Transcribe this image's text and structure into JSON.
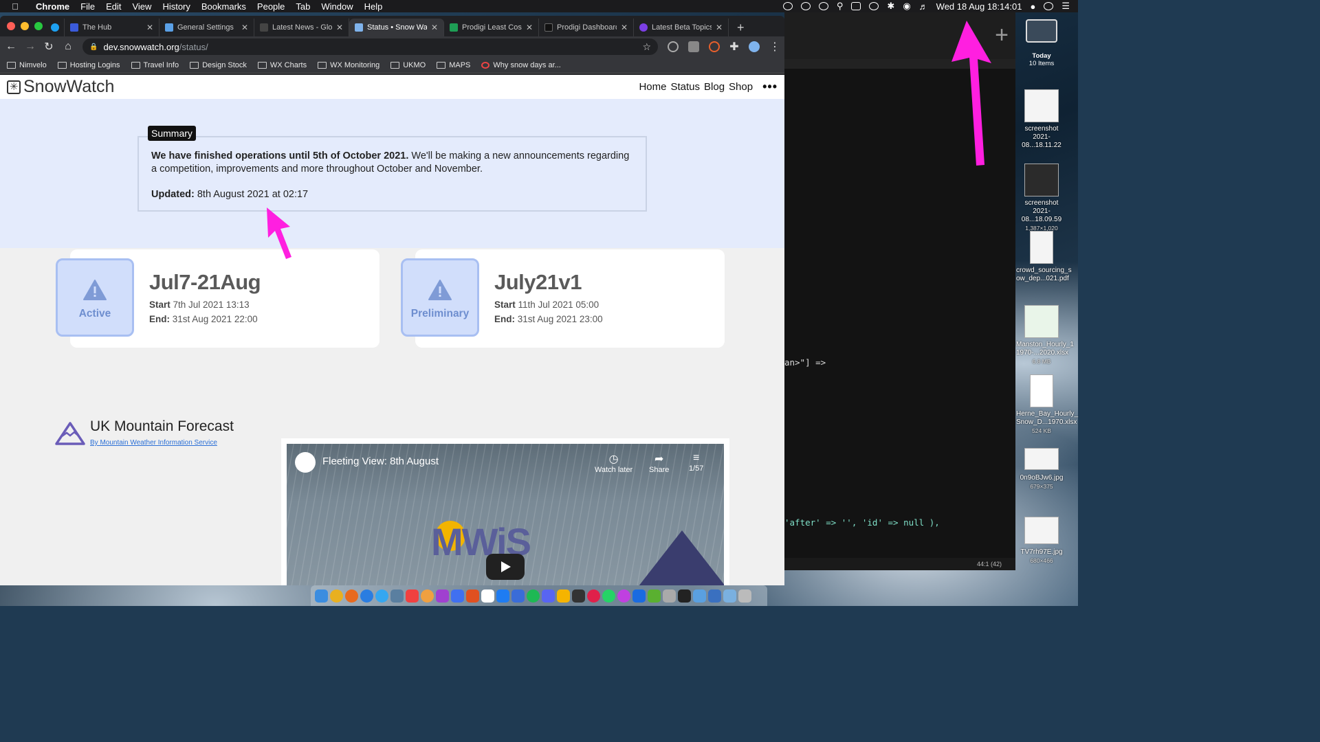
{
  "menubar": {
    "app": "Chrome",
    "items": [
      "File",
      "Edit",
      "View",
      "History",
      "Bookmarks",
      "People",
      "Tab",
      "Window",
      "Help"
    ],
    "clock": "Wed 18 Aug  18:14:01"
  },
  "tabs": [
    {
      "title": "",
      "color": "#1da1f2",
      "active": false
    },
    {
      "title": "The Hub",
      "color": "#3b5bdb",
      "active": false
    },
    {
      "title": "General Settings",
      "color": "#5aa0e6",
      "active": false
    },
    {
      "title": "Latest News - Glob",
      "color": "#444",
      "active": false
    },
    {
      "title": "Status • Snow Wat",
      "color": "#7fb3ec",
      "active": true
    },
    {
      "title": "Prodigi Least Cost",
      "color": "#1e9e55",
      "active": false
    },
    {
      "title": "Prodigi Dashboard",
      "color": "#111",
      "active": false
    },
    {
      "title": "Latest Beta Topics",
      "color": "#7b3fe4",
      "active": false
    }
  ],
  "address": {
    "host": "dev.snowwatch.org",
    "path": "/status/"
  },
  "bookmarks": [
    "Nimvelo",
    "Hosting Logins",
    "Travel Info",
    "Design Stock",
    "WX Charts",
    "WX Monitoring",
    "UKMO",
    "MAPS",
    "Why snow days ar..."
  ],
  "site": {
    "logo": "SnowWatch",
    "nav": [
      "Home",
      "Status",
      "Blog",
      "Shop"
    ],
    "more": "•••"
  },
  "summary": {
    "legend": "Summary",
    "bold": "We have finished operations until 5th of October 2021.",
    "rest": " We'll be making a new announcements regarding a competition, improvements and more throughout October and November.",
    "updated_label": "Updated:",
    "updated_value": " 8th August 2021 at 02:17"
  },
  "cards": [
    {
      "badge": "Active",
      "title": "Jul7-21Aug",
      "start_label": "Start",
      "start": " 7th Jul 2021 13:13",
      "end_label": "End:",
      "end": " 31st Aug 2021 22:00"
    },
    {
      "badge": "Preliminary",
      "title": "July21v1",
      "start_label": "Start",
      "start": " 11th Jul 2021 05:00",
      "end_label": "End:",
      "end": " 31st Aug 2021 23:00"
    }
  ],
  "forecast": {
    "title": "UK Mountain Forecast",
    "by": "By Mountain Weather Information Service"
  },
  "video": {
    "title": "Fleeting View: 8th August",
    "watch_later": "Watch later",
    "share": "Share",
    "count": "1/57",
    "brand": "MWiS"
  },
  "editor": {
    "line1": "an>\"]  =>",
    "line2": "'after' => '', 'id' => null ),",
    "status": "44:1 (42)"
  },
  "desktop": {
    "stack_label": "Today",
    "stack_count": "10 Items",
    "files": [
      {
        "name": "screenshot",
        "line2": "2021-08...18.11.22",
        "sub": ""
      },
      {
        "name": "screenshot",
        "line2": "2021-08...18.09.59",
        "sub": "1,387×1,020"
      },
      {
        "name": "crowd_sourcing_s",
        "line2": "ow_dep...021.pdf",
        "sub": ""
      },
      {
        "name": "Manston_Hourly_1",
        "line2": "1970-...2020.xlsx",
        "sub": "6.8 MB"
      },
      {
        "name": "Herne_Bay_Hourly_",
        "line2": "Snow_D...1970.xlsx",
        "sub": "524 KB"
      },
      {
        "name": "0n9oBJw6.jpg",
        "line2": "",
        "sub": "679×375"
      },
      {
        "name": "TV7rh97E.jpg",
        "line2": "",
        "sub": "680×466"
      }
    ]
  },
  "colors": {
    "arrow": "#ff1fe0",
    "badge_bg": "#d1defb",
    "summary_bg": "#e4ebfc"
  }
}
